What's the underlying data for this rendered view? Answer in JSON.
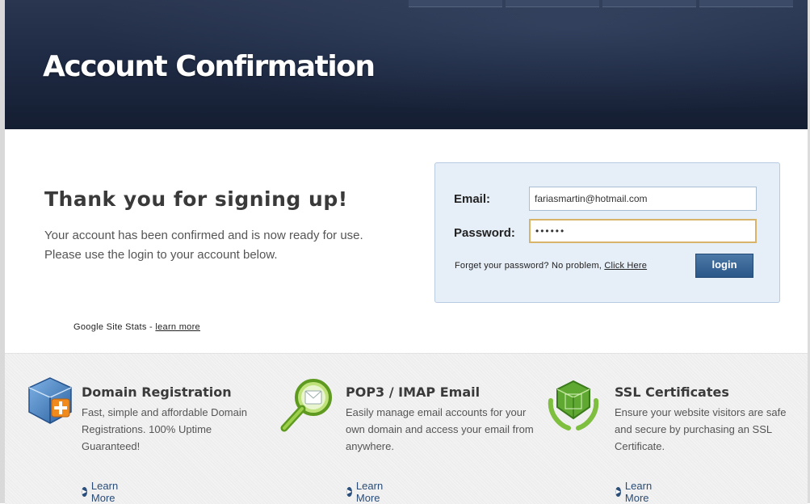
{
  "header": {
    "title": "Account Confirmation"
  },
  "main": {
    "heading": "Thank you for signing up!",
    "line1": "Your account has been confirmed and is now ready for use.",
    "line2": "Please use the login to your account below."
  },
  "stats": {
    "label": "Google Site Stats - ",
    "link": "learn more"
  },
  "login": {
    "email_label": "Email:",
    "email_value": "fariasmartin@hotmail.com",
    "password_label": "Password:",
    "password_value": "******",
    "forgot_text": "Forget your password? No problem, ",
    "forgot_link": "Click Here",
    "button_label": "login"
  },
  "features": [
    {
      "icon": "domain-box-icon",
      "title": "Domain Registration",
      "desc": "Fast, simple and affordable Domain Registrations. 100% Uptime Guaranteed!",
      "link": "Learn More"
    },
    {
      "icon": "magnifier-icon",
      "title": "POP3 / IMAP Email",
      "desc": "Easily manage email accounts for your own domain and access your email from anywhere.",
      "link": "Learn More"
    },
    {
      "icon": "ssl-shield-icon",
      "title": "SSL Certificates",
      "desc": "Ensure your website visitors are safe and secure by purchasing an SSL Certificate.",
      "link": "Learn More"
    }
  ],
  "colors": {
    "header_bg": "#1f2b44",
    "login_box_bg": "#e6eef7",
    "button_bg": "#2a5688",
    "link": "#2a4c76"
  }
}
